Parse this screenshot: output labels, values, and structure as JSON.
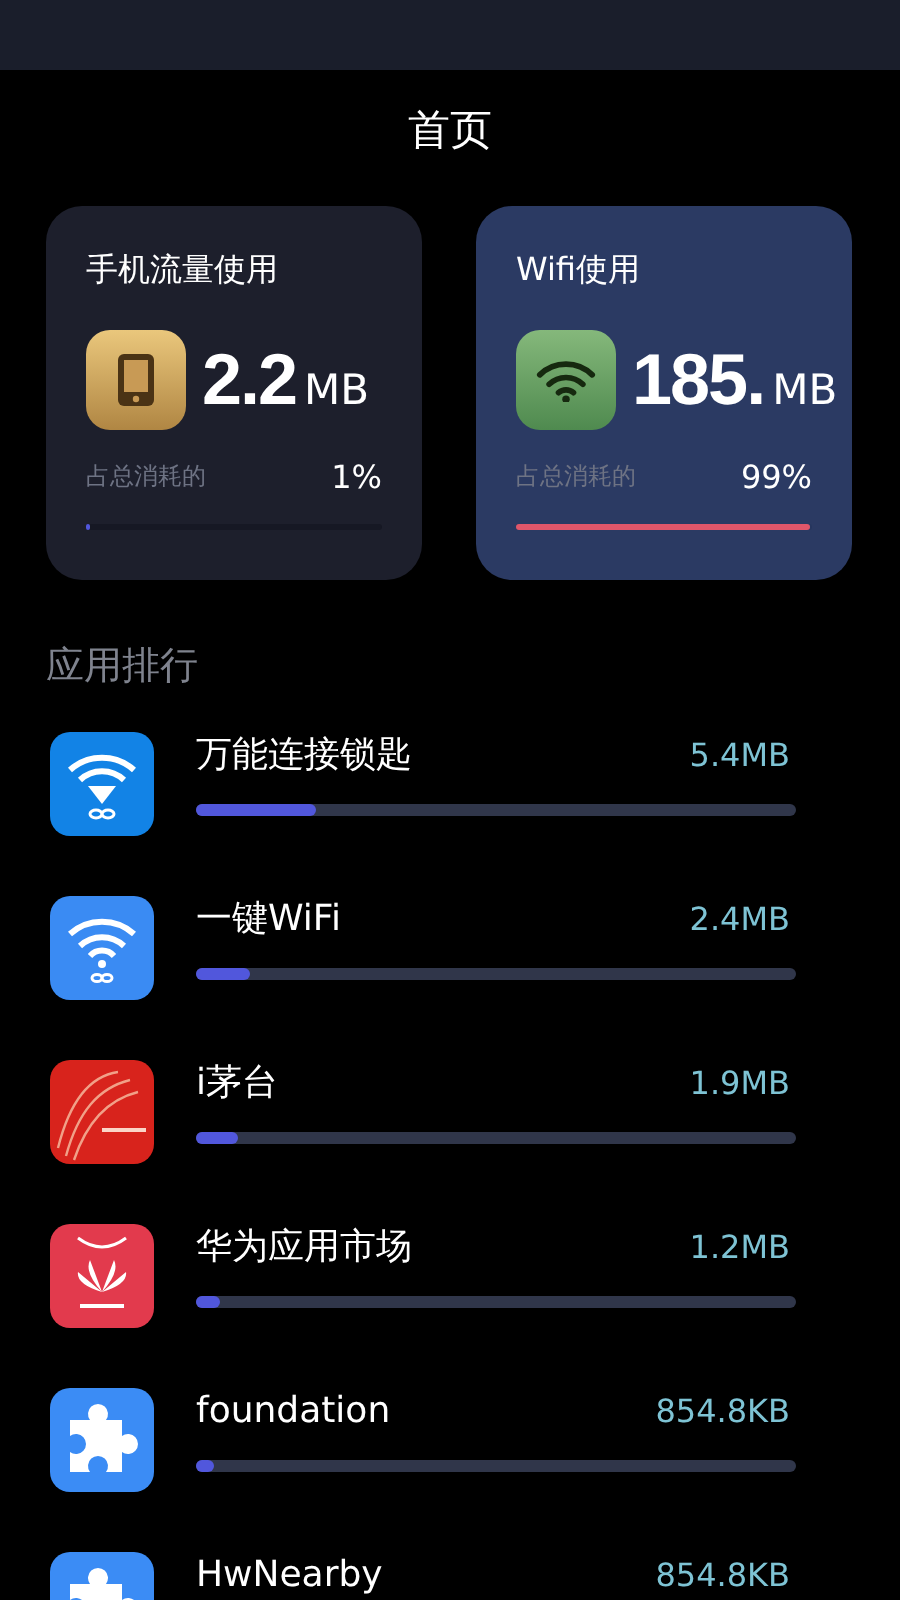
{
  "title": "首页",
  "cards": [
    {
      "kind": "mobile",
      "title": "手机流量使用",
      "amount": "2.2",
      "unit": "MB",
      "share_label": "占总消耗的",
      "share": "1%",
      "level": 0.01
    },
    {
      "kind": "wifi",
      "title": "Wifi使用",
      "amount": "185.",
      "unit": "MB",
      "share_label": "占总消耗的",
      "share": "99%",
      "level": 0.99
    }
  ],
  "section_title": "应用排行",
  "apps": [
    {
      "kind": "wifi-key",
      "name": "万能连接锁匙",
      "usage": "5.4MB",
      "level": 0.2
    },
    {
      "kind": "wifi",
      "name": "一键WiFi",
      "usage": "2.4MB",
      "level": 0.09
    },
    {
      "kind": "red-art",
      "name": "i茅台",
      "usage": "1.9MB",
      "level": 0.07
    },
    {
      "kind": "store",
      "name": "华为应用市场",
      "usage": "1.2MB",
      "level": 0.04
    },
    {
      "kind": "puzzle",
      "name": "foundation",
      "usage": "854.8KB",
      "level": 0.03
    },
    {
      "kind": "puzzle",
      "name": "HwNearby",
      "usage": "854.8KB"
    }
  ]
}
